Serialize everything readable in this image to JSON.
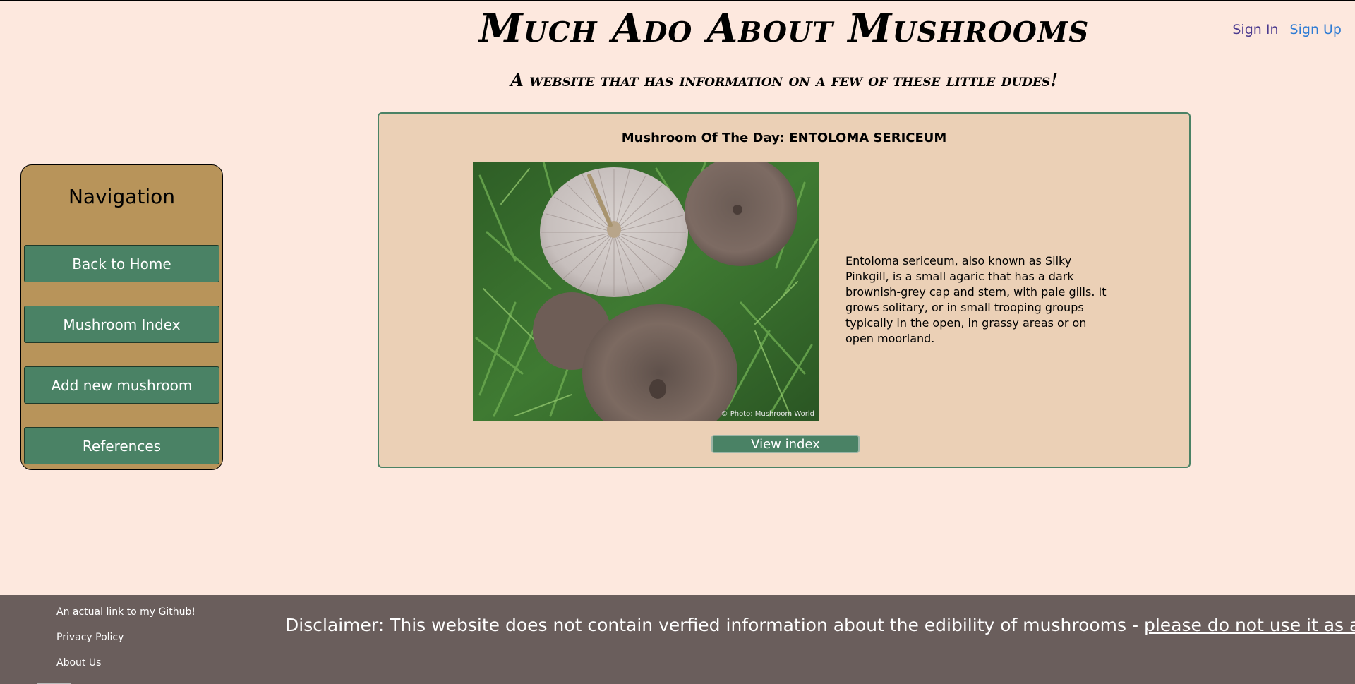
{
  "header": {
    "title": "Much Ado About Mushrooms",
    "subtitle": "A website that has information on a few of these little dudes!",
    "sign_in": "Sign In",
    "sign_up": "Sign Up"
  },
  "sidebar": {
    "title": "Navigation",
    "items": [
      {
        "label": "Back to Home"
      },
      {
        "label": "Mushroom Index"
      },
      {
        "label": "Add new mushroom"
      },
      {
        "label": "References"
      }
    ]
  },
  "motd": {
    "heading": "Mushroom Of The Day: ENTOLOMA SERICEUM",
    "photo_credit": "© Photo: Mushroom World",
    "description": "Entoloma sericeum, also known as Silky Pinkgill, is a small agaric that has a dark brownish-grey cap and stem, with pale gills. It grows solitary, or in small trooping groups typically in the open, in grassy areas or on open moorland.",
    "button_label": "View index"
  },
  "footer": {
    "links": [
      {
        "label": "An actual link to my Github!"
      },
      {
        "label": "Privacy Policy"
      },
      {
        "label": "About Us"
      }
    ],
    "disclaimer_text": "Disclaimer: This website does not contain verfied information about the edibility of mushrooms - ",
    "disclaimer_link": "please do not use it as a guide!"
  },
  "colors": {
    "page_bg": "#fde8de",
    "sidebar_bg": "#b8945a",
    "button_green": "#4a8265",
    "card_bg": "#ebd0b6",
    "footer_bg": "#6a5e5c",
    "sign_in": "#4b3a8f",
    "sign_up": "#2d7bd4"
  }
}
